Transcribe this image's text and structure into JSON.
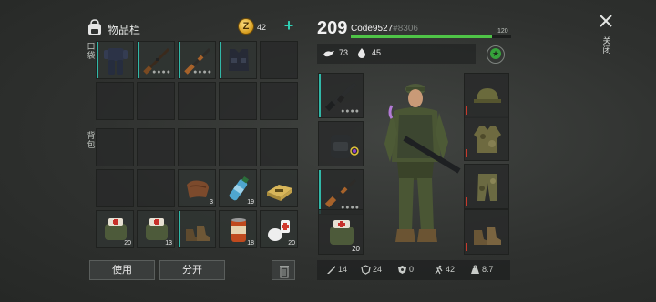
{
  "inventory": {
    "title": "物品栏",
    "coin_symbol": "Z",
    "coin_count": "42",
    "add_label": "+",
    "pocket_label": "口袋",
    "backpack_label": "背包",
    "pocket_items": [
      {
        "icon": "body-armor-icon",
        "qty": ""
      },
      {
        "icon": "rifle-icon",
        "qty": ""
      },
      {
        "icon": "rifle-wood-icon",
        "qty": ""
      },
      {
        "icon": "tactical-vest-icon",
        "qty": ""
      }
    ],
    "backpack_items": [
      {
        "icon": "leather-icon",
        "qty": "3"
      },
      {
        "icon": "water-bottle-icon",
        "qty": "19"
      },
      {
        "icon": "ration-box-icon",
        "qty": ""
      },
      {
        "icon": "medkit-bag-icon",
        "qty": "20"
      },
      {
        "icon": "medkit-bag-icon",
        "qty": "13"
      },
      {
        "icon": "boots-icon",
        "qty": ""
      },
      {
        "icon": "canned-food-icon",
        "qty": "18"
      },
      {
        "icon": "bandage-pills-icon",
        "qty": "20"
      }
    ],
    "use_label": "使用",
    "split_label": "分开"
  },
  "character": {
    "level": "209",
    "name": "Code9527",
    "id": "#8306",
    "xp_max": "120",
    "xp_fraction": 0.88,
    "hunger": "73",
    "thirst": "45",
    "equip_left": [
      {
        "icon": "assault-rifle-icon",
        "qty": ""
      },
      {
        "icon": "backpack-icon",
        "qty": ""
      },
      {
        "icon": "ak-rifle-icon",
        "qty": ""
      },
      {
        "icon": "medkit-bag-icon",
        "qty": "20"
      }
    ],
    "equip_right": [
      {
        "icon": "military-cap-icon"
      },
      {
        "icon": "camo-jacket-icon"
      },
      {
        "icon": "camo-pants-icon"
      },
      {
        "icon": "combat-boots-icon"
      }
    ],
    "stats": [
      {
        "icon": "attack-icon",
        "value": "14"
      },
      {
        "icon": "armor-icon",
        "value": "24"
      },
      {
        "icon": "radiation-icon",
        "value": "0"
      },
      {
        "icon": "speed-icon",
        "value": "42"
      },
      {
        "icon": "weight-icon",
        "value": "8.7"
      }
    ]
  },
  "close_label": "关闭",
  "colors": {
    "accent": "#31b8a8",
    "xp": "#4fc447",
    "badge": "#36a33b"
  }
}
